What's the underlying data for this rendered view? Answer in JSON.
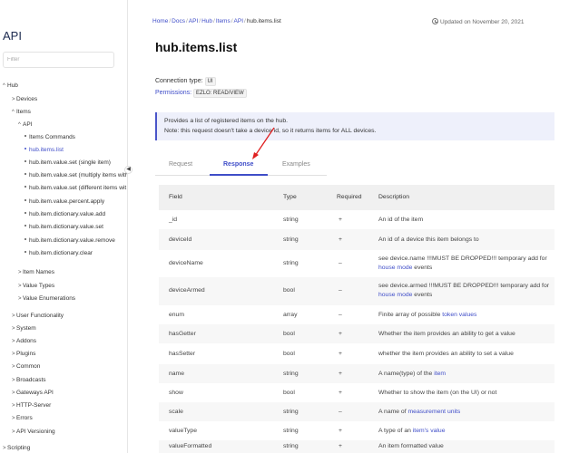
{
  "sidebar": {
    "title": "API",
    "filter_placeholder": "Filter",
    "items": [
      {
        "label": "Hub",
        "caret": "^",
        "indent": 0
      },
      {
        "label": "Devices",
        "caret": ">",
        "indent": 1
      },
      {
        "label": "Items",
        "caret": "^",
        "indent": 1
      },
      {
        "label": "API",
        "caret": "^",
        "indent": 2
      },
      {
        "label": "Items Commands",
        "bullet": true,
        "indent": 3
      },
      {
        "label": "hub.items.list",
        "bullet": true,
        "indent": 3,
        "selected": true
      },
      {
        "label": "hub.item.value.set (single item)",
        "bullet": true,
        "indent": 3
      },
      {
        "label": "hub.item.value.set (multiply items with",
        "bullet": true,
        "indent": 3
      },
      {
        "label": "hub.item.value.set (different items wit",
        "bullet": true,
        "indent": 3
      },
      {
        "label": "hub.item.value.percent.apply",
        "bullet": true,
        "indent": 3
      },
      {
        "label": "hub.item.dictionary.value.add",
        "bullet": true,
        "indent": 3
      },
      {
        "label": "hub.item.dictionary.value.set",
        "bullet": true,
        "indent": 3
      },
      {
        "label": "hub.item.dictionary.value.remove",
        "bullet": true,
        "indent": 3
      },
      {
        "label": "hub.item.dictionary.clear",
        "bullet": true,
        "indent": 3
      },
      {
        "label": "Item Names",
        "caret": ">",
        "indent": 2
      },
      {
        "label": "Value Types",
        "caret": ">",
        "indent": 2
      },
      {
        "label": "Value Enumerations",
        "caret": ">",
        "indent": 2
      },
      {
        "label": "User Functionality",
        "caret": ">",
        "indent": 1
      },
      {
        "label": "System",
        "caret": ">",
        "indent": 1
      },
      {
        "label": "Addons",
        "caret": ">",
        "indent": 1
      },
      {
        "label": "Plugins",
        "caret": ">",
        "indent": 1
      },
      {
        "label": "Common",
        "caret": ">",
        "indent": 1
      },
      {
        "label": "Broadcasts",
        "caret": ">",
        "indent": 1
      },
      {
        "label": "Gateways API",
        "caret": ">",
        "indent": 1
      },
      {
        "label": "HTTP-Server",
        "caret": ">",
        "indent": 1
      },
      {
        "label": "Errors",
        "caret": ">",
        "indent": 1
      },
      {
        "label": "API Versioning",
        "caret": ">",
        "indent": 1
      },
      {
        "label": "Scripting",
        "caret": ">",
        "indent": 0
      }
    ],
    "collapse_glyph": "◀"
  },
  "breadcrumb": {
    "items": [
      "Home",
      "Docs",
      "API",
      "Hub",
      "Items",
      "API"
    ],
    "separator": "/",
    "current": "hub.items.list"
  },
  "updated": "Updated on November 20, 2021",
  "title": "hub.items.list",
  "connection": {
    "label": "Connection type:",
    "value": "UI"
  },
  "permissions": {
    "label": "Permissions:",
    "value": "EZLO: READ/VIEW"
  },
  "info": {
    "line1": "Provides a list of registered items on the hub.",
    "line2": "Note: this request doesn't take a device id, so it returns items for ALL devices."
  },
  "tabs": [
    {
      "label": "Request",
      "active": false
    },
    {
      "label": "Response",
      "active": true
    },
    {
      "label": "Examples",
      "active": false
    }
  ],
  "table": {
    "headers": [
      "Field",
      "Type",
      "Required",
      "Description"
    ],
    "rows": [
      {
        "field": "_id",
        "type": "string",
        "required": "+",
        "desc": [
          {
            "t": "An id of the item"
          }
        ]
      },
      {
        "field": "deviceId",
        "type": "string",
        "required": "+",
        "desc": [
          {
            "t": "An id of a device this item belongs to"
          }
        ]
      },
      {
        "field": "deviceName",
        "type": "string",
        "required": "–",
        "desc": [
          {
            "t": "see device.name !!!MUST BE DROPPED!!! temporary add for "
          },
          {
            "t": "house mode",
            "link": true
          },
          {
            "t": " events"
          }
        ]
      },
      {
        "field": "deviceArmed",
        "type": "bool",
        "required": "–",
        "desc": [
          {
            "t": "see device.armed !!!MUST BE DROPPED!!! temporary add for "
          },
          {
            "t": "house mode",
            "link": true
          },
          {
            "t": " events"
          }
        ]
      },
      {
        "field": "enum",
        "type": "array",
        "required": "–",
        "desc": [
          {
            "t": "Finite array of possible "
          },
          {
            "t": "token values",
            "link": true
          }
        ]
      },
      {
        "field": "hasGetter",
        "type": "bool",
        "required": "+",
        "desc": [
          {
            "t": "Whether the item provides an ability to get a value"
          }
        ]
      },
      {
        "field": "hasSetter",
        "type": "bool",
        "required": "+",
        "desc": [
          {
            "t": "whether the item provides an ability to set a value"
          }
        ]
      },
      {
        "field": "name",
        "type": "string",
        "required": "+",
        "desc": [
          {
            "t": "A name(type) of the "
          },
          {
            "t": "item",
            "link": true
          }
        ]
      },
      {
        "field": "show",
        "type": "bool",
        "required": "+",
        "desc": [
          {
            "t": "Whether to show the item (on the UI) or not"
          }
        ]
      },
      {
        "field": "scale",
        "type": "string",
        "required": "–",
        "desc": [
          {
            "t": "A name of "
          },
          {
            "t": "measurement units",
            "link": true
          }
        ]
      },
      {
        "field": "valueType",
        "type": "string",
        "required": "+",
        "desc": [
          {
            "t": "A type of an "
          },
          {
            "t": "item's value",
            "link": true
          }
        ]
      },
      {
        "field": "valueFormatted",
        "type": "string",
        "required": "+",
        "desc": [
          {
            "t": "An item formatted value"
          }
        ]
      }
    ]
  },
  "colors": {
    "accent": "#3f4dc8",
    "info_bg": "#eef0fb",
    "arrow": "#e02020"
  }
}
